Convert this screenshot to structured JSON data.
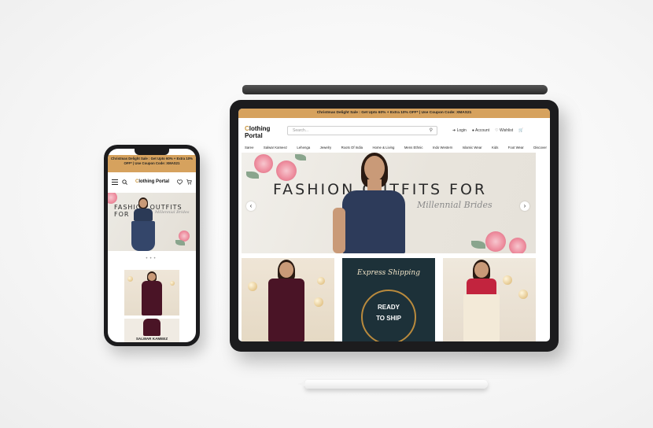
{
  "promo_banner": "Christmas Delight Sale : Get Upto 60% + Extra 10% OFF* | Use Coupon Code: XMAS21",
  "brand": {
    "first_letter": "C",
    "rest_line1": "lothing",
    "line2": "Portal",
    "full_rest": "lothing Portal"
  },
  "search": {
    "placeholder": "Search..."
  },
  "header_links": {
    "login": "Login",
    "account": "Account",
    "wishlist": "Wishlist"
  },
  "nav": [
    "Saree",
    "Salwar Kameez",
    "Lehenga",
    "Jewelry",
    "Roots Of India",
    "Home & Living",
    "Mens Ethnic",
    "Indo Western",
    "Islamic Wear",
    "Kids",
    "Foot Wear",
    "Discover"
  ],
  "hero": {
    "headline": "FASHION OUTFITS FOR",
    "subline": "Millennial Brides"
  },
  "tiles": {
    "shipping_title": "Express Shipping",
    "ready": "READY",
    "to_ship": "TO SHIP"
  },
  "phone": {
    "category_label": "SALWAR KAMEEZ",
    "hero_headline": "FASHION OUTFITS FOR",
    "hero_subline": "Millennial Brides",
    "dots": "•••"
  },
  "icons": [
    "menu-icon",
    "search-icon",
    "heart-icon",
    "cart-icon",
    "user-icon",
    "login-icon",
    "chevron-left-icon",
    "chevron-right-icon"
  ],
  "colors": {
    "banner": "#d6a25e",
    "logo_accent": "#c9963f",
    "shipping_tile": "#1d3139"
  }
}
